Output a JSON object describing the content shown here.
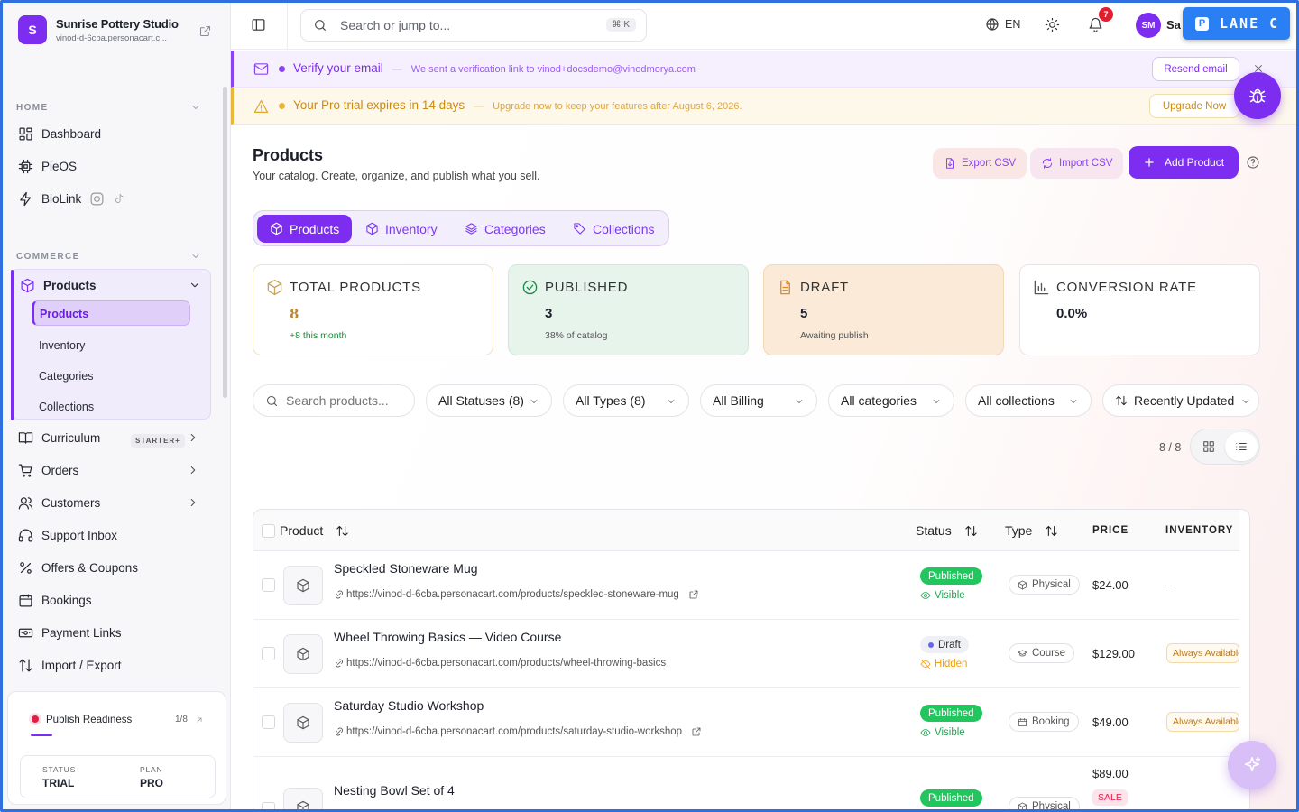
{
  "brand": {
    "initial": "S",
    "name": "Sunrise Pottery Studio",
    "domain": "vinod-d-6cba.personacart.c..."
  },
  "sidebar": {
    "home_section": "HOME",
    "home_items": [
      {
        "label": "Dashboard",
        "icon": "dashboard-icon"
      },
      {
        "label": "PieOS",
        "icon": "chip-icon"
      },
      {
        "label": "BioLink",
        "icon": "bolt-icon"
      }
    ],
    "commerce_section": "COMMERCE",
    "products_label": "Products",
    "products_sub": [
      "Products",
      "Inventory",
      "Categories",
      "Collections"
    ],
    "commerce_items": [
      {
        "label": "Curriculum",
        "icon": "book-icon"
      },
      {
        "label": "Orders",
        "icon": "cart-icon"
      },
      {
        "label": "Customers",
        "icon": "users-icon"
      },
      {
        "label": "Support Inbox",
        "icon": "headset-icon"
      },
      {
        "label": "Offers & Coupons",
        "icon": "percent-icon"
      },
      {
        "label": "Bookings",
        "icon": "calendar-icon"
      },
      {
        "label": "Payment Links",
        "icon": "payment-link-icon"
      },
      {
        "label": "Import / Export",
        "icon": "arrows-updown-icon"
      }
    ],
    "curriculum_badge": "STARTER+",
    "readiness": {
      "title": "Publish Readiness",
      "count": "1/8",
      "progress": 0.125,
      "status_label": "STATUS",
      "status_value": "TRIAL",
      "plan_label": "PLAN",
      "plan_value": "PRO"
    }
  },
  "topbar": {
    "search_placeholder": "Search or jump to...",
    "search_shortcut": "⌘ K",
    "language": "EN",
    "notifications_count": "7",
    "avatar_initials": "SM",
    "user_name": "Sa",
    "lane_label": "LANE C",
    "lane_icon_letter": "P"
  },
  "banners": {
    "verify": {
      "title": "Verify your email",
      "subtitle": "We sent a verification link to vinod+docsdemo@vinodmorya.com",
      "button": "Resend email",
      "color": "#8b45f0"
    },
    "trial": {
      "title": "Your Pro trial expires in 14 days",
      "subtitle": "Upgrade now to keep your features after August 6, 2026.",
      "button": "Upgrade Now",
      "color": "#e8b73a"
    }
  },
  "page": {
    "title": "Products",
    "subtitle": "Your catalog. Create, organize, and publish what you sell.",
    "export_csv": "Export CSV",
    "import_csv": "Import CSV",
    "add_product": "Add Product"
  },
  "tabs": [
    "Products",
    "Inventory",
    "Categories",
    "Collections"
  ],
  "stats": [
    {
      "label": "TOTAL PRODUCTS",
      "value": "8",
      "note": "+8 this month"
    },
    {
      "label": "PUBLISHED",
      "value": "3",
      "note": "38% of catalog"
    },
    {
      "label": "DRAFT",
      "value": "5",
      "note": "Awaiting publish"
    },
    {
      "label": "CONVERSION RATE",
      "value": "0.0%",
      "note": ""
    }
  ],
  "filters": {
    "search_placeholder": "Search products...",
    "status": "All Statuses (8)",
    "type": "All Types (8)",
    "billing": "All Billing",
    "categories": "All categories",
    "collections": "All collections",
    "sort": "Recently Updated"
  },
  "count_label": "8 / 8",
  "table": {
    "headers": {
      "product": "Product",
      "status": "Status",
      "type": "Type",
      "price": "PRICE",
      "inventory": "INVENTORY"
    },
    "rows": [
      {
        "name": "Speckled Stoneware Mug",
        "url": "https://vinod-d-6cba.personacart.com/products/speckled-stoneware-mug",
        "status": "Published",
        "visibility": "Visible",
        "type": "Physical",
        "price": "$24.00",
        "inventory": "–"
      },
      {
        "name": "Wheel Throwing Basics — Video Course",
        "url": "https://vinod-d-6cba.personacart.com/products/wheel-throwing-basics",
        "status": "Draft",
        "visibility": "Hidden",
        "type": "Course",
        "price": "$129.00",
        "inventory": "Always Available"
      },
      {
        "name": "Saturday Studio Workshop",
        "url": "https://vinod-d-6cba.personacart.com/products/saturday-studio-workshop",
        "status": "Published",
        "visibility": "Visible",
        "type": "Booking",
        "price": "$49.00",
        "inventory": "Always Available"
      },
      {
        "name": "Nesting Bowl Set of 4",
        "url": "",
        "status": "Published",
        "visibility": "",
        "type": "Physical",
        "price": "$89.00",
        "sale": "SALE",
        "inventory": ""
      }
    ]
  },
  "colors": {
    "accent": "#7c2df0",
    "published": "#22c55e",
    "draft": "#6366f1",
    "hidden": "#f59e0b"
  }
}
